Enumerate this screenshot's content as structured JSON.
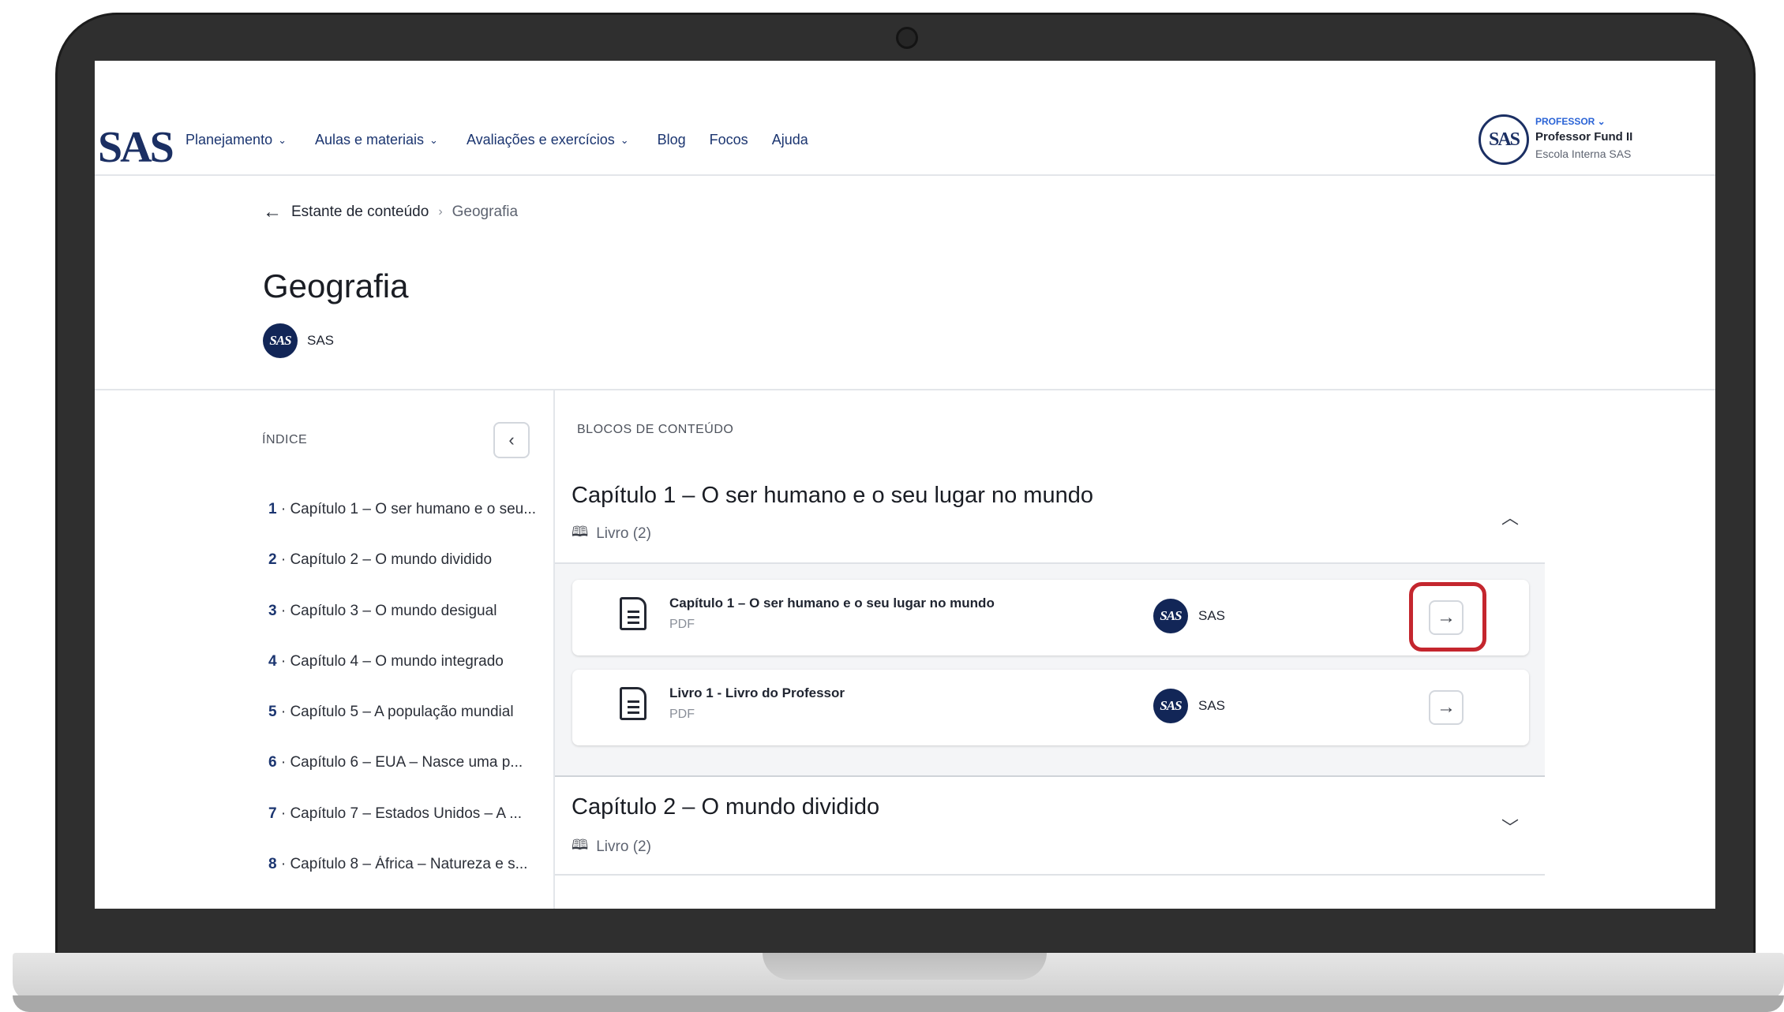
{
  "header": {
    "logo": "SAS",
    "nav": [
      {
        "label": "Planejamento",
        "chevron": "chevron-down-icon"
      },
      {
        "label": "Aulas e materiais",
        "chevron": "chevron-down-icon"
      },
      {
        "label": "Avaliações e exercícios",
        "chevron": "chevron-down-icon"
      },
      {
        "label": "Blog"
      },
      {
        "label": "Focos"
      },
      {
        "label": "Ajuda"
      }
    ],
    "user": {
      "avatar": "SAS",
      "role": "PROFESSOR ⌄",
      "name": "Professor Fund II",
      "school": "Escola Interna SAS"
    }
  },
  "breadcrumb": {
    "root": "Estante de conteúdo",
    "separator": "›",
    "current": "Geografia"
  },
  "page": {
    "title": "Geografia",
    "author_badge": "SAS",
    "author": "SAS"
  },
  "index": {
    "title": "ÍNDICE",
    "items": [
      {
        "num": "1",
        "label": " · Capítulo 1 – O ser humano e o seu..."
      },
      {
        "num": "2",
        "label": " · Capítulo 2 – O mundo dividido"
      },
      {
        "num": "3",
        "label": " · Capítulo 3 – O mundo desigual"
      },
      {
        "num": "4",
        "label": " · Capítulo 4 – O mundo integrado"
      },
      {
        "num": "5",
        "label": " · Capítulo 5 – A população mundial"
      },
      {
        "num": "6",
        "label": " · Capítulo 6 – EUA – Nasce uma p..."
      },
      {
        "num": "7",
        "label": " · Capítulo 7 – Estados Unidos – A ..."
      },
      {
        "num": "8",
        "label": " · Capítulo 8 – África – Natureza e s..."
      }
    ]
  },
  "content": {
    "title": "BLOCOS DE CONTEÚDO",
    "chapters": [
      {
        "title": "Capítulo 1 – O ser humano e o seu lugar no mundo",
        "meta": "Livro (2)",
        "expanded": true,
        "items": [
          {
            "title": "Capítulo 1 – O ser humano e o seu lugar no mundo",
            "type": "PDF",
            "badge": "SAS",
            "author": "SAS",
            "highlighted": true
          },
          {
            "title": "Livro 1 - Livro do Professor",
            "type": "PDF",
            "badge": "SAS",
            "author": "SAS",
            "highlighted": false
          }
        ]
      },
      {
        "title": "Capítulo 2 – O mundo dividido",
        "meta": "Livro (2)",
        "expanded": false
      }
    ]
  },
  "colors": {
    "brand_navy": "#122657",
    "nav_text": "#1b3570",
    "highlight": "#c4262e",
    "role_blue": "#2a63d6"
  }
}
